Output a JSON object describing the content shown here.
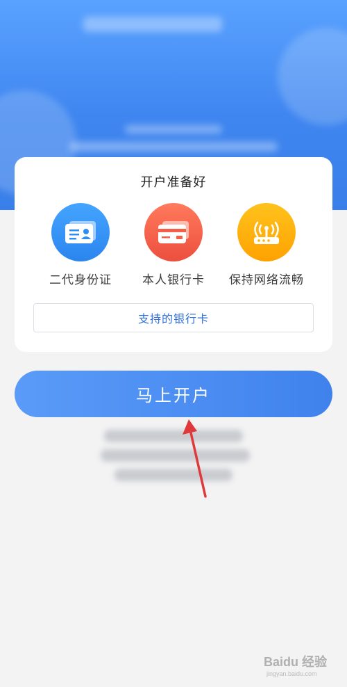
{
  "card": {
    "title": "开户准备好",
    "items": [
      {
        "label": "二代身份证",
        "icon": "id-card-icon",
        "color": "#2f8ef5"
      },
      {
        "label": "本人银行卡",
        "icon": "bank-card-icon",
        "color": "#f2604a"
      },
      {
        "label": "保持网络流畅",
        "icon": "router-icon",
        "color": "#ffb300"
      }
    ],
    "supported_banks_label": "支持的银行卡"
  },
  "open_account_button": "马上开户",
  "watermark": {
    "logo": "Baidu 经验",
    "url": "jingyan.baidu.com"
  },
  "colors": {
    "accent": "#4a8cf1",
    "link": "#2f6fd8",
    "arrow": "#e0393b"
  }
}
